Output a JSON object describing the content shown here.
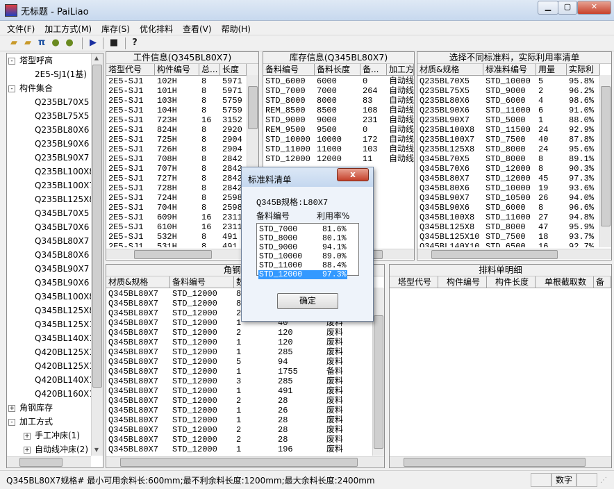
{
  "window": {
    "title": "无标题 - PaiLiao"
  },
  "menu": [
    "文件(F)",
    "加工方式(M)",
    "库存(S)",
    "优化排料",
    "查看(V)",
    "帮助(H)"
  ],
  "tree": {
    "root1": "塔型呼高",
    "root1_child": "2E5-SJ1(1基)",
    "root2": "构件集合",
    "specs": [
      "Q235BL70X5",
      "Q235BL75X5",
      "Q235BL80X6",
      "Q235BL90X6",
      "Q235BL90X7",
      "Q235BL100X8",
      "Q235BL100X7",
      "Q235BL125X8",
      "Q345BL70X5",
      "Q345BL70X6",
      "Q345BL80X7",
      "Q345BL80X6",
      "Q345BL90X7",
      "Q345BL90X6",
      "Q345BL100X8",
      "Q345BL125X8",
      "Q345BL125X1",
      "Q345BL140X1",
      "Q420BL125X1",
      "Q420BL125X1",
      "Q420BL140X1",
      "Q420BL160X1"
    ],
    "root3": "角钢库存",
    "root4": "加工方式",
    "child4a": "手工冲床(1)",
    "child4b": "自动线冲床(2)"
  },
  "workpiece": {
    "title": "工件信息(Q345BL80X7)",
    "headers": [
      "塔型代号",
      "构件编号",
      "总...",
      "长度"
    ],
    "rows": [
      [
        "2E5-SJ1",
        "102H",
        "8",
        "5971"
      ],
      [
        "2E5-SJ1",
        "101H",
        "8",
        "5971"
      ],
      [
        "2E5-SJ1",
        "103H",
        "8",
        "5759"
      ],
      [
        "2E5-SJ1",
        "104H",
        "8",
        "5759"
      ],
      [
        "2E5-SJ1",
        "723H",
        "16",
        "3152"
      ],
      [
        "2E5-SJ1",
        "824H",
        "8",
        "2920"
      ],
      [
        "2E5-SJ1",
        "725H",
        "8",
        "2904"
      ],
      [
        "2E5-SJ1",
        "726H",
        "8",
        "2904"
      ],
      [
        "2E5-SJ1",
        "708H",
        "8",
        "2842"
      ],
      [
        "2E5-SJ1",
        "707H",
        "8",
        "2842"
      ],
      [
        "2E5-SJ1",
        "727H",
        "8",
        "2842"
      ],
      [
        "2E5-SJ1",
        "728H",
        "8",
        "2842"
      ],
      [
        "2E5-SJ1",
        "724H",
        "8",
        "2598"
      ],
      [
        "2E5-SJ1",
        "704H",
        "8",
        "2598"
      ],
      [
        "2E5-SJ1",
        "609H",
        "16",
        "2311"
      ],
      [
        "2E5-SJ1",
        "610H",
        "16",
        "2311"
      ],
      [
        "2E5-SJ1",
        "532H",
        "8",
        "491"
      ],
      [
        "2E5-SJ1",
        "531H",
        "8",
        "491"
      ]
    ]
  },
  "stock": {
    "title": "库存信息(Q345BL80X7)",
    "headers": [
      "备料编号",
      "备料长度",
      "备...",
      "加工方"
    ],
    "rows": [
      [
        "STD_6000",
        "6000",
        "0",
        "自动线"
      ],
      [
        "STD_7000",
        "7000",
        "264",
        "自动线"
      ],
      [
        "STD_8000",
        "8000",
        "83",
        "自动线"
      ],
      [
        "REM_8500",
        "8500",
        "108",
        "自动线"
      ],
      [
        "STD_9000",
        "9000",
        "231",
        "自动线"
      ],
      [
        "REM_9500",
        "9500",
        "0",
        "自动线"
      ],
      [
        "STD_10000",
        "10000",
        "172",
        "自动线"
      ],
      [
        "STD_11000",
        "11000",
        "103",
        "自动线"
      ],
      [
        "STD_12000",
        "12000",
        "11",
        "自动线"
      ]
    ]
  },
  "utilization": {
    "title": "选择不同标准料，实际利用率清单",
    "headers": [
      "材质&规格",
      "标准料编号",
      "用量",
      "实际利"
    ],
    "rows": [
      [
        "Q235BL70X5",
        "STD_10000",
        "5",
        "95.8%"
      ],
      [
        "Q235BL75X5",
        "STD_9000",
        "2",
        "96.2%"
      ],
      [
        "Q235BL80X6",
        "STD_6000",
        "4",
        "98.6%"
      ],
      [
        "Q235BL90X6",
        "STD_11000",
        "6",
        "91.0%"
      ],
      [
        "Q235BL90X7",
        "STD_5000",
        "1",
        "88.0%"
      ],
      [
        "Q235BL100X8",
        "STD_11500",
        "24",
        "92.9%"
      ],
      [
        "Q235BL100X7",
        "STD_7500",
        "40",
        "87.8%"
      ],
      [
        "Q235BL125X8",
        "STD_8000",
        "24",
        "95.6%"
      ],
      [
        "Q345BL70X5",
        "STD_8000",
        "8",
        "89.1%"
      ],
      [
        "Q345BL70X6",
        "STD_12000",
        "8",
        "90.3%"
      ],
      [
        "Q345BL80X7",
        "STD_12000",
        "45",
        "97.3%"
      ],
      [
        "Q345BL80X6",
        "STD_10000",
        "19",
        "93.6%"
      ],
      [
        "Q345BL90X7",
        "STD_10500",
        "26",
        "94.0%"
      ],
      [
        "Q345BL90X6",
        "STD_6000",
        "8",
        "96.6%"
      ],
      [
        "Q345BL100X8",
        "STD_11000",
        "27",
        "94.8%"
      ],
      [
        "Q345BL125X8",
        "STD_8000",
        "47",
        "95.9%"
      ],
      [
        "Q345BL125X10",
        "STD_7500",
        "18",
        "93.7%"
      ],
      [
        "Q345BL140X10",
        "STD_6500",
        "16",
        "92.7%"
      ]
    ]
  },
  "nesting": {
    "title": "角钢排料单",
    "headers": [
      "材质&规格",
      "备料编号",
      "数",
      "",
      "",
      ""
    ],
    "rows": [
      [
        "Q345BL80X7",
        "STD_12000",
        "8",
        "",
        "",
        ""
      ],
      [
        "Q345BL80X7",
        "STD_12000",
        "8",
        "",
        "",
        ""
      ],
      [
        "Q345BL80X7",
        "STD_12000",
        "2",
        "",
        "",
        ""
      ],
      [
        "Q345BL80X7",
        "STD_12000",
        "1",
        "40",
        "",
        "废料"
      ],
      [
        "Q345BL80X7",
        "STD_12000",
        "2",
        "120",
        "",
        "废料"
      ],
      [
        "Q345BL80X7",
        "STD_12000",
        "1",
        "120",
        "",
        "废料"
      ],
      [
        "Q345BL80X7",
        "STD_12000",
        "1",
        "285",
        "",
        "废料"
      ],
      [
        "Q345BL80X7",
        "STD_12000",
        "5",
        "94",
        "",
        "废料"
      ],
      [
        "Q345BL80X7",
        "STD_12000",
        "1",
        "1755",
        "",
        "备料"
      ],
      [
        "Q345BL80X7",
        "STD_12000",
        "3",
        "285",
        "",
        "废料"
      ],
      [
        "Q345BL80X7",
        "STD_12000",
        "1",
        "491",
        "",
        "废料"
      ],
      [
        "Q345BL80X7",
        "STD_12000",
        "2",
        "28",
        "",
        "废料"
      ],
      [
        "Q345BL80X7",
        "STD_12000",
        "1",
        "26",
        "",
        "废料"
      ],
      [
        "Q345BL80X7",
        "STD_12000",
        "1",
        "28",
        "",
        "废料"
      ],
      [
        "Q345BL80X7",
        "STD_12000",
        "2",
        "28",
        "",
        "废料"
      ],
      [
        "Q345BL80X7",
        "STD_12000",
        "2",
        "28",
        "",
        "废料"
      ],
      [
        "Q345BL80X7",
        "STD_12000",
        "1",
        "196",
        "",
        "废料"
      ]
    ]
  },
  "detail": {
    "title": "排料单明细",
    "headers": [
      "塔型代号",
      "构件编号",
      "构件长度",
      "单根截取数",
      "备"
    ]
  },
  "dialog": {
    "title": "标准料清单",
    "spec_label": "Q345B规格:L80X7",
    "col1": "备料编号",
    "col2": "利用率%",
    "rows": [
      [
        "STD_7000",
        "81.6%"
      ],
      [
        "STD_8000",
        "80.1%"
      ],
      [
        "STD_9000",
        "94.1%"
      ],
      [
        "STD_10000",
        "89.0%"
      ],
      [
        "STD_11000",
        "88.4%"
      ],
      [
        "STD_12000",
        "97.3%"
      ]
    ],
    "selected_index": 5,
    "ok": "确定",
    "close": "x"
  },
  "status": {
    "text": "Q345BL80X7规格# 最小可用余料长:600mm;最不利余料长度:1200mm;最大余料长度:2400mm",
    "mode": "数字"
  }
}
